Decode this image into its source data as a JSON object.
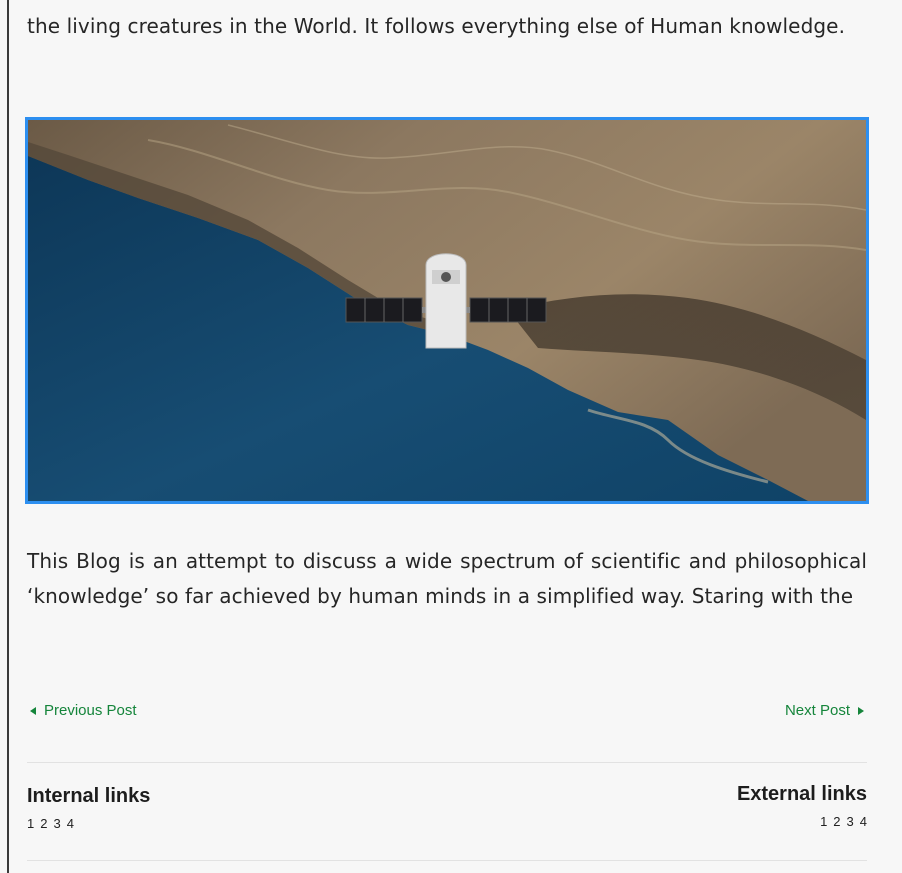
{
  "article": {
    "intro_text": "the living creatures in the World. It follows everything else of Human knowledge.",
    "image_icon": "satellite-over-earth-image",
    "body_text": "This Blog is an attempt to discuss a wide spectrum of scientific and philosophical ‘knowledge’ so far achieved by human minds in a simplified way. Staring with the"
  },
  "post_nav": {
    "previous_label": "Previous Post",
    "next_label": "Next Post",
    "previous_icon": "triangle-left-icon",
    "next_icon": "triangle-right-icon",
    "link_color": "#15853b"
  },
  "links": {
    "internal": {
      "heading": "Internal links",
      "items": [
        "1",
        "2",
        "3",
        "4"
      ]
    },
    "external": {
      "heading": "External links",
      "items": [
        "1",
        "2",
        "3",
        "4"
      ]
    }
  },
  "colors": {
    "image_border": "#2d8ff0",
    "background": "#f7f7f7"
  }
}
